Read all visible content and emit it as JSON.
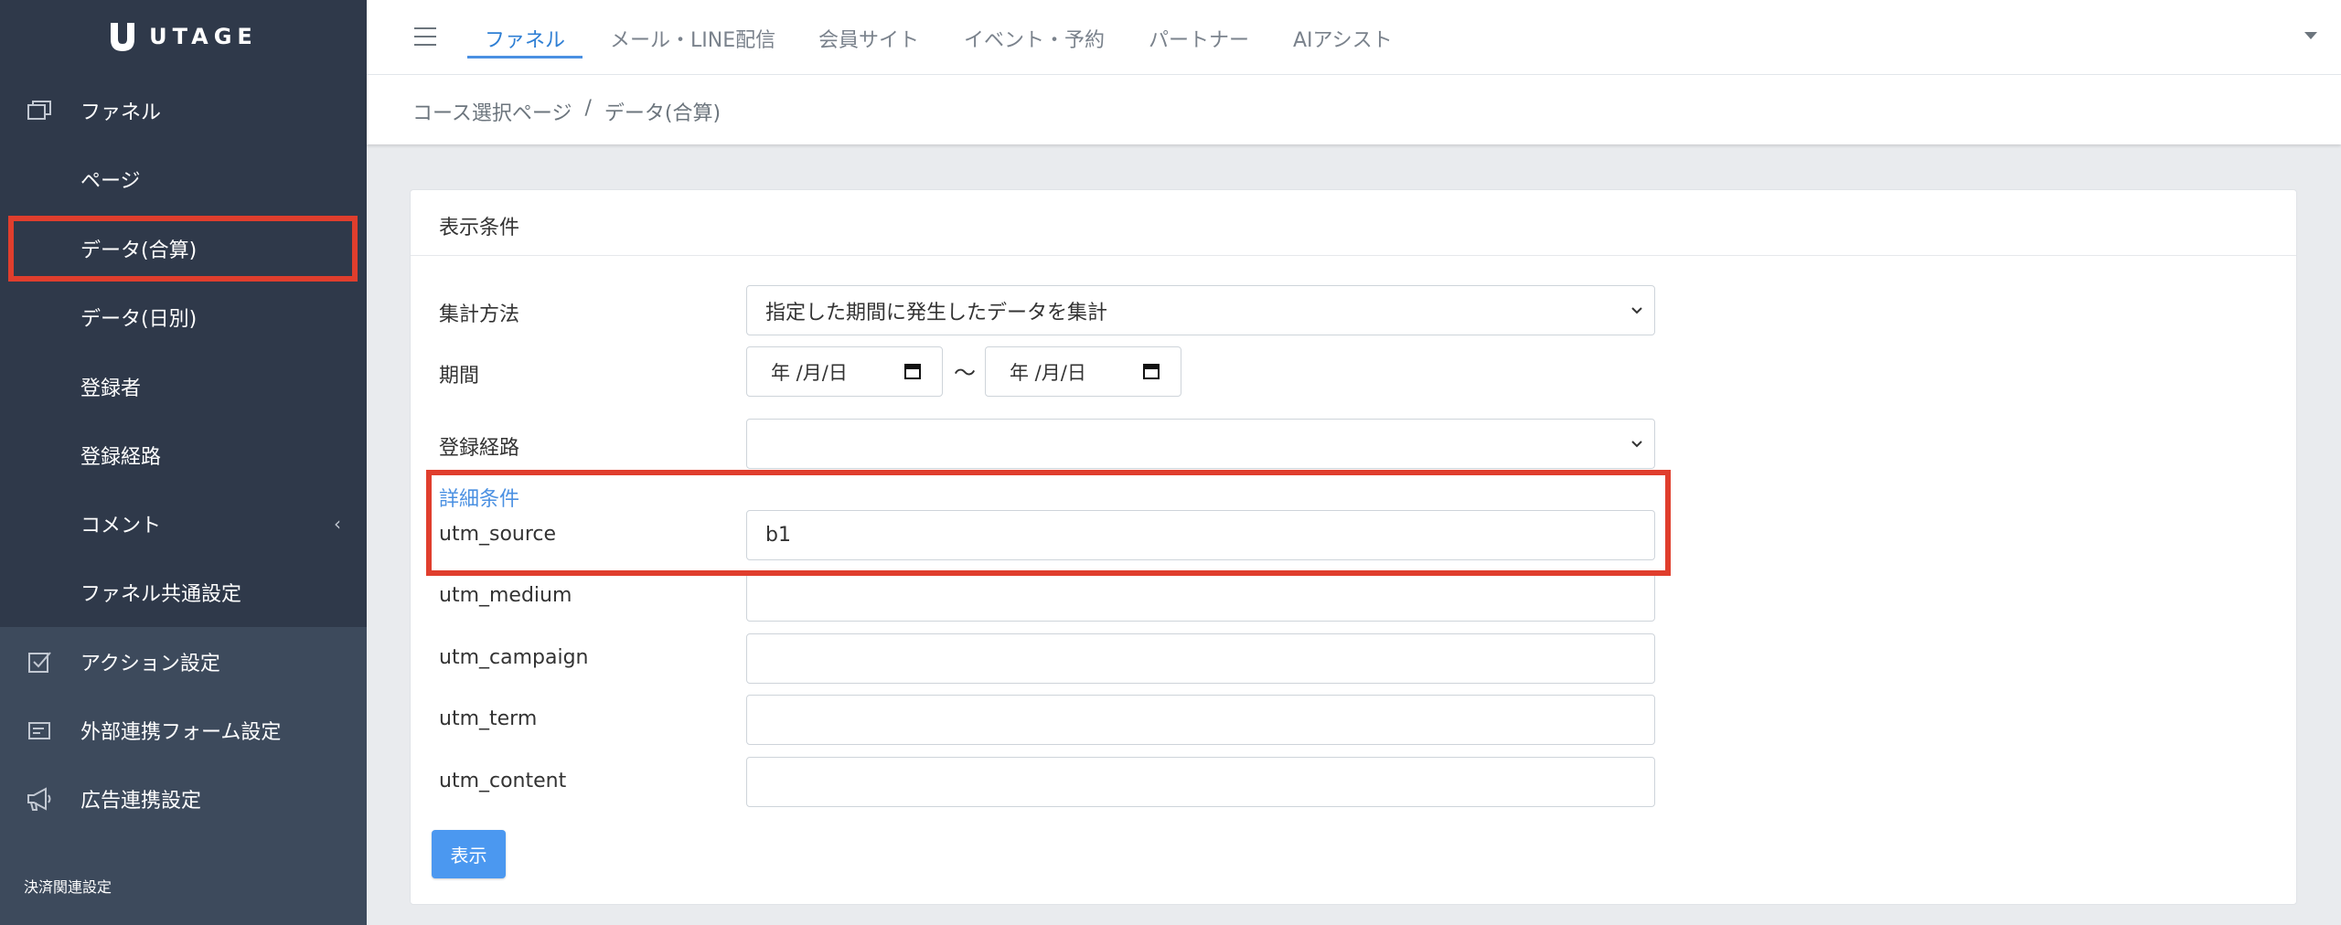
{
  "brand": {
    "name": "UTAGE"
  },
  "sidebar": {
    "items": [
      {
        "label": "ファネル",
        "icon": "windows-icon"
      },
      {
        "label": "ページ"
      },
      {
        "label": "データ(合算)"
      },
      {
        "label": "データ(日別)"
      },
      {
        "label": "登録者"
      },
      {
        "label": "登録経路"
      },
      {
        "label": "コメント",
        "chevron": "‹"
      },
      {
        "label": "ファネル共通設定"
      },
      {
        "label": "アクション設定",
        "icon": "checkbox-icon"
      },
      {
        "label": "外部連携フォーム設定",
        "icon": "form-icon"
      },
      {
        "label": "広告連携設定",
        "icon": "megaphone-icon"
      }
    ],
    "section_label": "決済関連設定",
    "active_item": "データ(合算)"
  },
  "header": {
    "tabs": [
      {
        "label": "ファネル"
      },
      {
        "label": "メール・LINE配信"
      },
      {
        "label": "会員サイト"
      },
      {
        "label": "イベント・予約"
      },
      {
        "label": "パートナー"
      },
      {
        "label": "AIアシスト"
      }
    ],
    "active_tab": "ファネル"
  },
  "breadcrumb": {
    "items": [
      "コース選択ページ",
      "/",
      "データ(合算)"
    ]
  },
  "card": {
    "title": "表示条件",
    "aggregation": {
      "label": "集計方法",
      "value": "指定した期間に発生したデータを集計"
    },
    "period": {
      "label": "期間",
      "start_placeholder": "年 /月/日",
      "end_placeholder": "年 /月/日",
      "separator": "〜"
    },
    "route": {
      "label": "登録経路",
      "value": ""
    },
    "detail_link": "詳細条件",
    "fields": [
      {
        "label": "utm_source",
        "value": "b1"
      },
      {
        "label": "utm_medium",
        "value": ""
      },
      {
        "label": "utm_campaign",
        "value": ""
      },
      {
        "label": "utm_term",
        "value": ""
      },
      {
        "label": "utm_content",
        "value": ""
      }
    ],
    "submit_label": "表示"
  },
  "colors": {
    "sidebar_dark": "#2f394a",
    "sidebar_light": "#3d4a5c",
    "accent": "#4a90e2",
    "highlight": "#e03e2d",
    "button": "#4b98f0"
  }
}
